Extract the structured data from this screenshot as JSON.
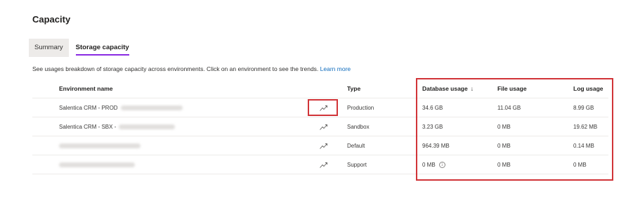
{
  "page": {
    "title": "Capacity"
  },
  "tabs": [
    {
      "label": "Summary",
      "active": false
    },
    {
      "label": "Storage capacity",
      "active": true
    }
  ],
  "description": {
    "text": "See usages breakdown of storage capacity across environments. Click on an environment to see the trends.",
    "link": "Learn more"
  },
  "table": {
    "headers": {
      "environment": "Environment name",
      "type": "Type",
      "database": "Database usage",
      "sort_arrow": "↓",
      "file": "File usage",
      "log": "Log usage"
    },
    "rows": [
      {
        "name": "Salentica CRM - PROD",
        "type": "Production",
        "database": "34.6 GB",
        "file": "11.04 GB",
        "log": "8.99 GB"
      },
      {
        "name": "Salentica CRM - SBX -",
        "type": "Sandbox",
        "database": "3.23 GB",
        "file": "0 MB",
        "log": "19.62 MB"
      },
      {
        "name": "",
        "type": "Default",
        "database": "964.39 MB",
        "file": "0 MB",
        "log": "0.14 MB"
      },
      {
        "name": "",
        "type": "Support",
        "database": "0 MB",
        "file": "0 MB",
        "log": "0 MB"
      }
    ]
  },
  "icons": {
    "trend": "chart-trend-icon",
    "info": "info-icon"
  },
  "colors": {
    "highlight": "#d13438",
    "active_tab": "#8a2be2",
    "link": "#0f6cbd"
  }
}
